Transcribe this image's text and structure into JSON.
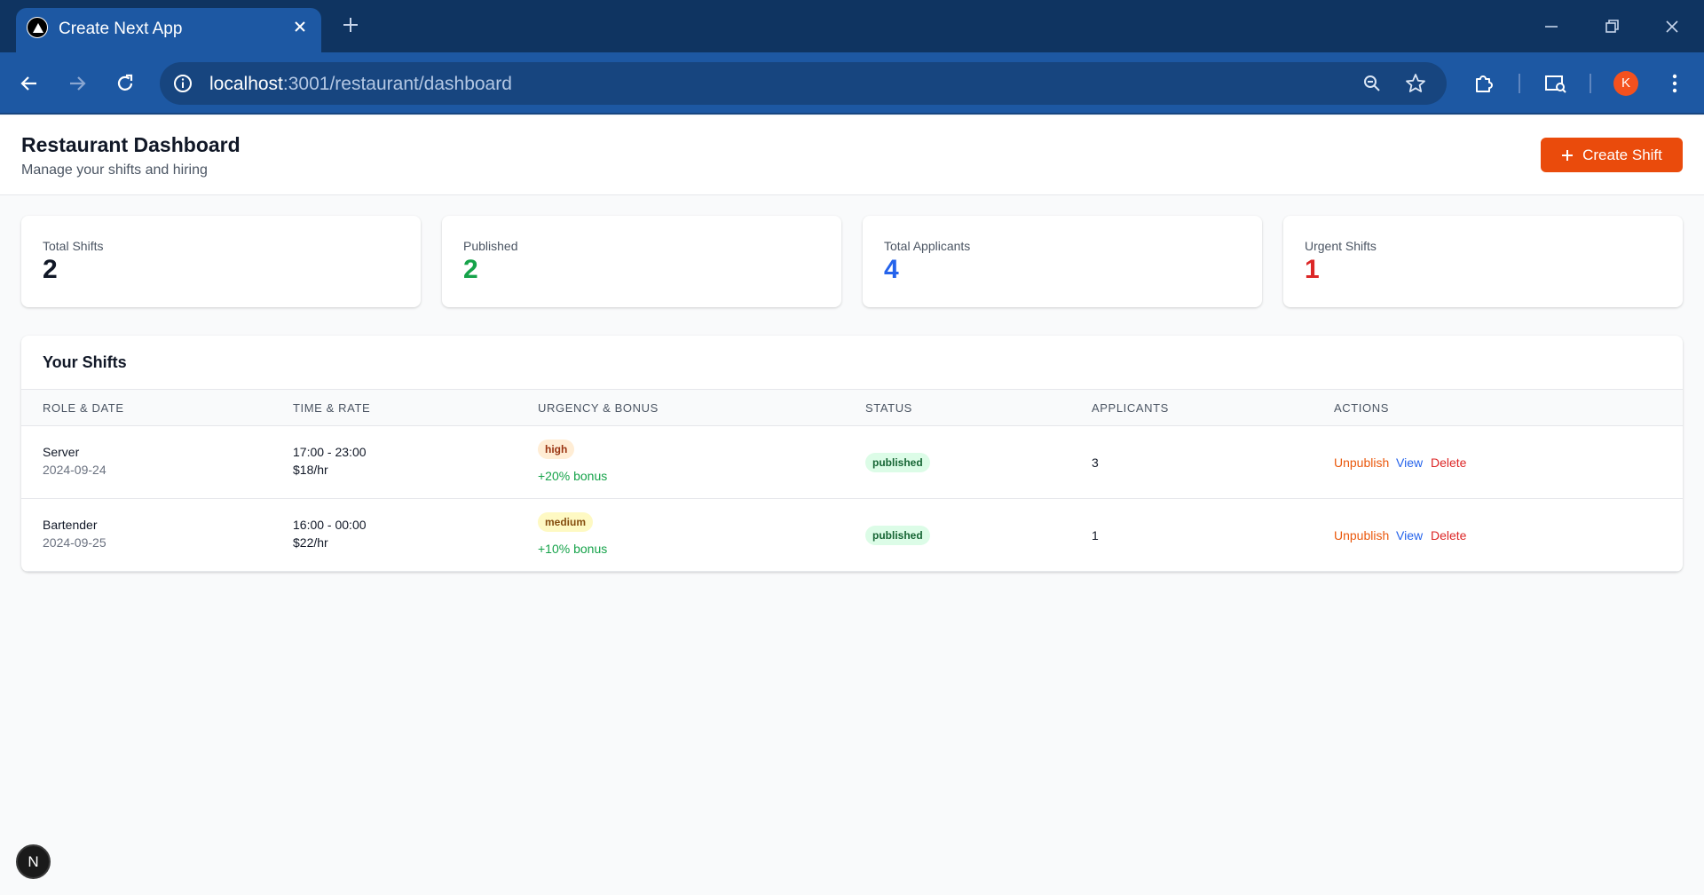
{
  "browser": {
    "tab_title": "Create Next App",
    "url_host": "localhost",
    "url_path": ":3001/restaurant/dashboard",
    "profile_initial": "K"
  },
  "header": {
    "title": "Restaurant Dashboard",
    "subtitle": "Manage your shifts and hiring",
    "create_button": "Create Shift"
  },
  "stats": [
    {
      "label": "Total Shifts",
      "value": "2",
      "color": "#111827"
    },
    {
      "label": "Published",
      "value": "2",
      "color": "#16a34a"
    },
    {
      "label": "Total Applicants",
      "value": "4",
      "color": "#2563eb"
    },
    {
      "label": "Urgent Shifts",
      "value": "1",
      "color": "#dc2626"
    }
  ],
  "shifts": {
    "title": "Your Shifts",
    "columns": [
      "ROLE & DATE",
      "TIME & RATE",
      "URGENCY & BONUS",
      "STATUS",
      "APPLICANTS",
      "ACTIONS"
    ],
    "rows": [
      {
        "role": "Server",
        "date": "2024-09-24",
        "time": "17:00 - 23:00",
        "rate": "$18/hr",
        "urgency": "high",
        "bonus": "+20% bonus",
        "status": "published",
        "applicants": "3",
        "actions": [
          "Unpublish",
          "View",
          "Delete"
        ]
      },
      {
        "role": "Bartender",
        "date": "2024-09-25",
        "time": "16:00 - 00:00",
        "rate": "$22/hr",
        "urgency": "medium",
        "bonus": "+10% bonus",
        "status": "published",
        "applicants": "1",
        "actions": [
          "Unpublish",
          "View",
          "Delete"
        ]
      }
    ]
  },
  "colors": {
    "accent": "#ea4b0c",
    "urgency_high_bg": "#ffedd5",
    "urgency_high_text": "#9a3412",
    "urgency_medium_bg": "#fef9c3",
    "urgency_medium_text": "#854d0e",
    "status_bg": "#dcfce7",
    "status_text": "#166534",
    "action_unpublish": "#ea580c",
    "action_view": "#2563eb",
    "action_delete": "#dc2626"
  },
  "dev_badge": "N"
}
